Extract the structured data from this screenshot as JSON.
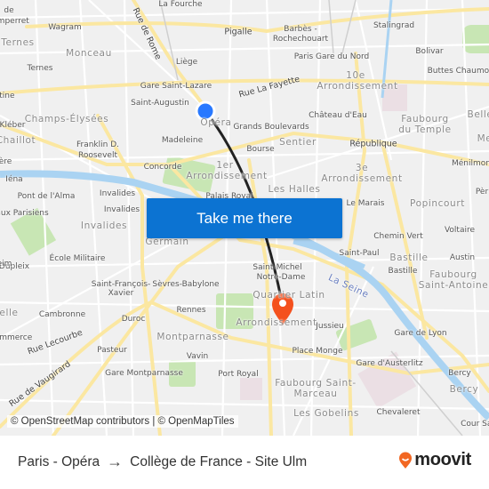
{
  "map": {
    "labels": [
      "La Fourche",
      "Pigalle",
      "Barbès -",
      "Rochechouart",
      "Stalingrad",
      "Wagram",
      "Ternes",
      "Monceau",
      "Liège",
      "Paris Gare du Nord",
      "Bolivar",
      "Buttes Chaumont",
      "10e",
      "Arrondissement",
      "Gare Saint-Lazare",
      "Rue La Fayette",
      "Saint-Augustin",
      "Opéra",
      "Grands Boulevards",
      "Château d'Eau",
      "Faubourg",
      "du Temple",
      "Belle",
      "Champs-Élysées",
      "Kléber",
      "Chaillot",
      "Madeleine",
      "Sentier",
      "République",
      "Franklin D.",
      "Roosevelt",
      "Bourse",
      "Ménilmon",
      "Concorde",
      "1er",
      "Arrondissement",
      "3e",
      "Arrondissement",
      "Iéna",
      "Pont de l'Alma",
      "Invalides",
      "Palais Royal",
      "Les Halles",
      "Le Marais",
      "Popincourt",
      "Invalides",
      "aux Parisiens",
      "Invalides",
      "Germain",
      "Chemin Vert",
      "Voltaire",
      "Saint-Paul",
      "École Militaire",
      "Bastille",
      "Bastille",
      "Faubourg",
      "Saint-Antoine",
      "Saint-Michel",
      "Notre-Dame",
      "La Seine",
      "Saint-François-",
      "Xavier",
      "Sèvres-Babylone",
      "Dupleix",
      "Quartier Latin",
      "Cambronne",
      "Rennes",
      "Duroc",
      "Arrondissement",
      "Jussieu",
      "Gare de Lyon",
      "Montparnasse",
      "Rue Lecourbe",
      "Pasteur",
      "Place Monge",
      "Vavin",
      "Gare d'Austerlitz",
      "Gare Montparnasse",
      "Port Royal",
      "Bercy",
      "Rue de Vaugirard",
      "Faubourg Saint-",
      "Marceau",
      "Bercy",
      "Les Gobelins",
      "Chevaleret",
      "Cour Sai",
      "Rue de Rome",
      "de",
      "amperret",
      "Ternes",
      "ntine",
      "ère",
      "Pèr",
      "Me",
      "Austin",
      "eim",
      "elle",
      "ommerce"
    ],
    "attribution": "© OpenStreetMap contributors | © OpenMapTiles",
    "origin_marker_color": "#2979ff",
    "destination_marker_color": "#f4511e",
    "route_color": "#222222",
    "water_color": "#aad3f2",
    "park_color": "#c8e6b4",
    "major_road_color": "#fbe7a1"
  },
  "cta": {
    "label": "Take me there",
    "color": "#0c73d2"
  },
  "footer": {
    "origin": "Paris - Opéra",
    "arrow_icon": "→",
    "destination": "Collège de France - Site Ulm",
    "logo_text": "moovit",
    "logo_color": "#f26722"
  }
}
